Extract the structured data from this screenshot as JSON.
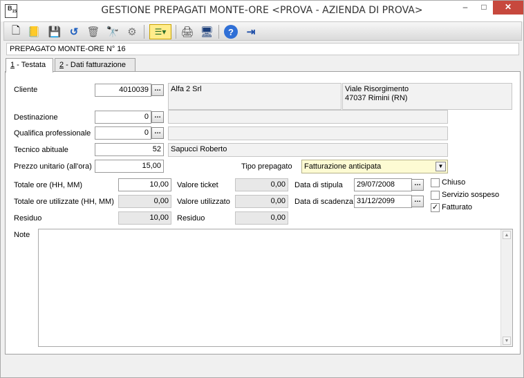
{
  "window": {
    "title": "GESTIONE PREPAGATI MONTE-ORE <PROVA - AZIENDA DI PROVA>",
    "app_icon_text": "B",
    "app_icon_sub": "15",
    "minimize_glyph": "–",
    "maximize_glyph": "□",
    "close_glyph": "✕"
  },
  "toolbar": {
    "icons": {
      "new": "🗋",
      "open": "📒",
      "save": "💾",
      "undo": "↺",
      "delete": "🗑",
      "find": "🔭",
      "settings": "⚙",
      "list": "☰▾",
      "print": "🖨",
      "preview": "🖥",
      "help": "?",
      "exit": "⇥"
    }
  },
  "document_label": "PREPAGATO MONTE-ORE N° 16",
  "tabs": [
    {
      "num": "1",
      "label": " - Testata"
    },
    {
      "num": "2",
      "label": " - Dati fatturazione"
    }
  ],
  "form": {
    "cliente_label": "Cliente",
    "cliente_code": "4010039",
    "cliente_name": "Alfa 2 Srl",
    "cliente_address_line1": "Viale Risorgimento",
    "cliente_address_line2": "47037 Rimini (RN)",
    "destinazione_label": "Destinazione",
    "destinazione_value": "0",
    "qualifica_label": "Qualifica professionale",
    "qualifica_value": "0",
    "tecnico_label": "Tecnico abituale",
    "tecnico_code": "52",
    "tecnico_name": "Sapucci Roberto",
    "prezzo_label": "Prezzo unitario (all'ora)",
    "prezzo_value": "15,00",
    "tipo_label": "Tipo prepagato",
    "tipo_value": "Fatturazione anticipata",
    "totale_ore_label": "Totale ore (HH, MM)",
    "totale_ore_value": "10,00",
    "totale_utilizzate_label": "Totale ore utilizzate (HH, MM)",
    "totale_utilizzate_value": "0,00",
    "residuo_label": "Residuo",
    "residuo_value": "10,00",
    "valore_ticket_label": "Valore ticket",
    "valore_ticket_value": "0,00",
    "valore_utilizzato_label": "Valore utilizzato",
    "valore_utilizzato_value": "0,00",
    "residuo2_label": "Residuo",
    "residuo2_value": "0,00",
    "data_stipula_label": "Data di stipula",
    "data_stipula_value": "29/07/2008",
    "data_scadenza_label": "Data di scadenza",
    "data_scadenza_value": "31/12/2099",
    "chiuso_label": "Chiuso",
    "chiuso_checked": false,
    "sospeso_label": "Servizio sospeso",
    "sospeso_checked": false,
    "fatturato_label": "Fatturato",
    "fatturato_mark": "✓",
    "note_label": "Note",
    "dots": "…"
  },
  "colors": {
    "close_button": "#c7483d",
    "select_bg": "#fdfbd3"
  }
}
